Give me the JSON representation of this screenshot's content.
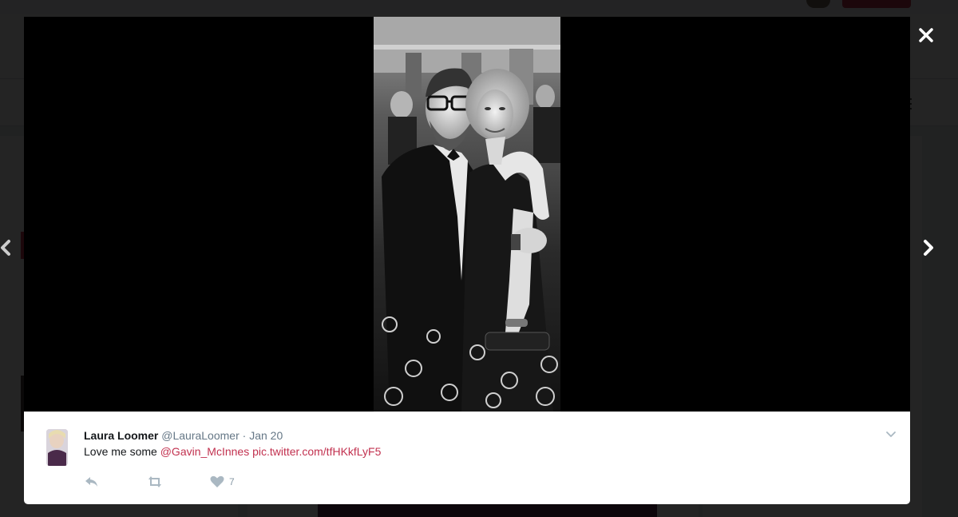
{
  "viewer": {
    "close_icon": "close-icon",
    "next_icon": "chevron-right-icon",
    "prev_icon": "chevron-left-icon"
  },
  "tweet": {
    "name": "Laura Loomer",
    "handle": "@LauraLoomer",
    "separator": "·",
    "time": "Jan 20",
    "text": "Love me some",
    "mention": "@Gavin_McInnes",
    "pic_link": "pic.twitter.com/tfHKkfLyF5",
    "like_count": "7",
    "link_color": "#c2314f"
  }
}
